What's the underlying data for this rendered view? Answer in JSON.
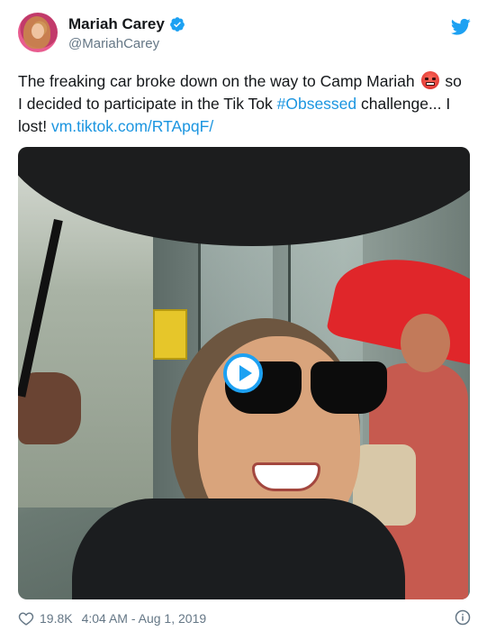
{
  "tweet": {
    "author": {
      "display_name": "Mariah Carey",
      "handle": "@MariahCarey",
      "verified": true
    },
    "text_parts": {
      "part1": "The freaking car broke down on the way to Camp Mariah ",
      "part2": " so I decided to participate in the Tik Tok ",
      "hashtag": "#Obsessed",
      "part3": " challenge... I lost! ",
      "link": "vm.tiktok.com/RTApqF/"
    },
    "emoji": "angry-face-with-symbols",
    "media": {
      "type": "video",
      "play_icon": "play-icon"
    },
    "footer": {
      "likes": "19.8K",
      "timestamp": "4:04 AM - Aug 1, 2019"
    },
    "icons": {
      "brand": "twitter-bird-icon",
      "verified": "verified-badge-icon",
      "like": "heart-icon",
      "info": "info-icon"
    },
    "colors": {
      "link": "#1b95e0",
      "brand_blue": "#1da1f2",
      "muted": "#657786",
      "text": "#14171a"
    }
  }
}
